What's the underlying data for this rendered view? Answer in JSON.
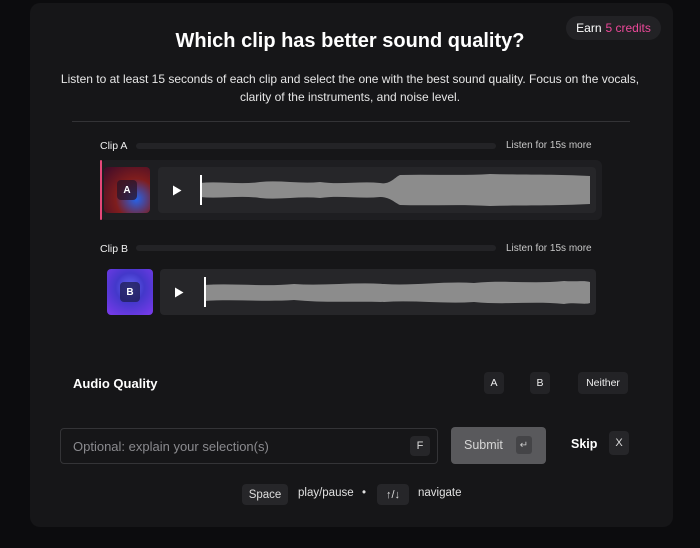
{
  "header": {
    "earn_label": "Earn",
    "earn_credits": "5 credits",
    "title": "Which clip has better sound quality?",
    "instructions": "Listen to at least 15 seconds of each clip and select the one with the best sound quality. Focus on the vocals, clarity of the instruments, and noise level."
  },
  "clips": [
    {
      "label": "Clip A",
      "listen_text": "Listen for 15s more",
      "badge": "A",
      "listen_progress": 0,
      "play_icon": "play-icon",
      "selected": true
    },
    {
      "label": "Clip B",
      "listen_text": "Listen for 15s more",
      "badge": "B",
      "listen_progress": 0,
      "play_icon": "play-icon",
      "selected": false
    }
  ],
  "question": {
    "label": "Audio Quality",
    "options": [
      "A",
      "B",
      "Neither"
    ]
  },
  "explain": {
    "placeholder": "Optional: explain your selection(s)",
    "shortcut": "F"
  },
  "submit": {
    "label": "Submit",
    "shortcut": "↵"
  },
  "skip": {
    "label": "Skip",
    "shortcut": "X"
  },
  "hints": {
    "space_key": "Space",
    "space_action": "play/pause",
    "separator": "•",
    "nav_key": "↑/↓",
    "nav_action": "navigate"
  },
  "colors": {
    "accent": "#ec4899",
    "background": "#0c0c0e",
    "card": "#161618",
    "waveform": "#8c8c8c"
  }
}
